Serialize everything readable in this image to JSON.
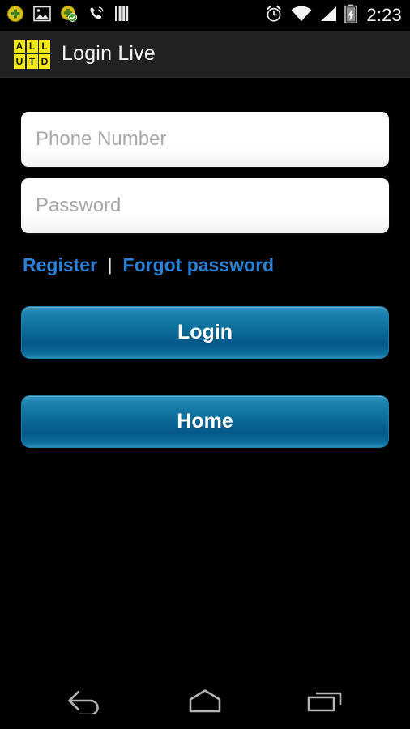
{
  "status_bar": {
    "icons_left": [
      "notification-dot-green-icon",
      "gallery-image-icon",
      "sync-complete-icon",
      "call-ringing-icon",
      "sim-signal-bars-icon"
    ],
    "icons_right": [
      "alarm-clock-icon",
      "wifi-icon",
      "cellular-signal-icon",
      "battery-charging-icon"
    ],
    "time": "2:23"
  },
  "action_bar": {
    "logo_name": "all-utd-logo",
    "logo_letters_top": [
      "A",
      "L",
      "L"
    ],
    "logo_letters_bottom": [
      "U",
      "T",
      "D"
    ],
    "logo_color": "#f2e816",
    "title": "Login Live"
  },
  "form": {
    "phone": {
      "value": "",
      "placeholder": "Phone Number"
    },
    "password": {
      "value": "",
      "placeholder": "Password"
    },
    "register_label": "Register",
    "separator": "|",
    "forgot_label": "Forgot password",
    "link_color": "#2a82d8"
  },
  "buttons": {
    "login_label": "Login",
    "home_label": "Home",
    "accent_color": "#0a6a96"
  },
  "nav_bar": {
    "back_label": "Back",
    "home_label": "Home",
    "recents_label": "Recent apps"
  }
}
